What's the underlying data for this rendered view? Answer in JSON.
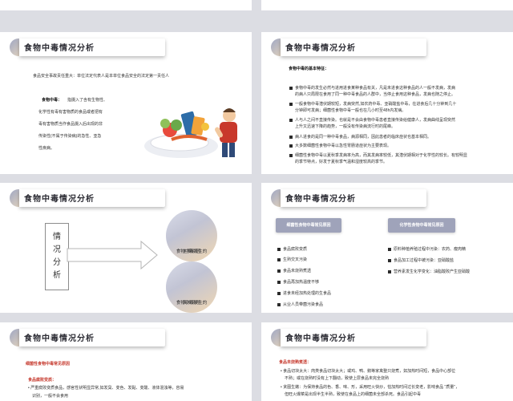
{
  "header_title": "食物中毒情况分析",
  "s1": {
    "intro": "食品安全事故责任重大：单位法定代表人是本单位食品安全的法定第一责任人",
    "def_title": "食物中毒：",
    "def_lines": [
      "指摄入了含有生物性、",
      "化学性有毒有害物质的食品或者把有",
      "毒有害物质当作食品摄入后出现的非",
      "传染性(不属于传染病)的急性、亚急",
      "性疾病。"
    ]
  },
  "s2": {
    "subtitle": "食物中毒的基本特征：",
    "items": [
      [
        "食物中毒的发生必然与进用进食某种食品有关，凡是未进食这种食品的人一般不发病，发病",
        "的病人只局限在食用了同一种中毒食品的人群中，当停止食用这种食品，发病也随之停止。"
      ],
      [
        "一般食物中毒潜伏期较短，发病突然,如农药中毒、亚硝酸盐中毒，在进食后几十分钟到几十",
        "分钟即可发病；细菌性食物中毒一般也在几小时至48h内发病。"
      ],
      [
        "人与人之间不直接传染。也就是不会由食物中毒患者直接传染给健康人，发病曲线呈现突然",
        "上升又迅速下降的趋势，一般没有传染病流行时的尾峰。"
      ],
      [
        "病人进食的是同一种中毒食品，病源相同，因此患者的临床症状也基本相同。"
      ],
      [
        "大多数细菌性食物中毒以急性胃肠道症状为主要表现。"
      ],
      [
        "细菌性食物中毒以夏秋季发病率为高，而其发病率较低，其潜伏期相对于化学性的较长。有较明显",
        "的季节特点，好发于夏秋季气温和湿度较高的季节。"
      ]
    ]
  },
  "s3": {
    "vertical_chars": [
      "情",
      "况",
      "分",
      "析"
    ],
    "circle1": [
      "食物中毒发生的",
      "主要原因"
    ],
    "circle2": [
      "食物中毒发生的",
      "高发场所"
    ]
  },
  "s4": {
    "left_tab": "细菌性食物中毒常见原因",
    "right_tab": "化学性食物中毒常见原因",
    "left_items": [
      "食品腐败变质",
      "生熟交叉污染",
      "食品未烧熟煮透",
      "食品再加热温度不够",
      "进食未经加热处理的生食品",
      "从业人员带菌污染食品"
    ],
    "right_items": [
      "原料种植养殖过程中污染：农药、瘦肉精",
      "食品加工过程中被污染：亚硝酸盐",
      "营养素发生化学变化：油脂酸败产生亚硝酸"
    ]
  },
  "s5": {
    "heading": "细菌性食物中毒常见原因",
    "sub": "食品腐败变质：",
    "lines": [
      "严重腐败变质食品，感官性状明显异常,如发臭、变色、发黏、变酸、液体混浊等，容易",
      "识别，一般不会食用"
    ]
  },
  "s6": {
    "sub": "食品未烧熟煮透：",
    "lines": [
      "食品切块太大：肉类食品切块太大；或鸡、鸭、鹅等家禽整只烧煮，如加热时间短，食品中心部位",
      "不熟；或在烧熟时没有上下翻动，致使上层食品未完全烧熟",
      "贪图生嫩：为保持食品的色、香、味、形，采用旺火快炒，怕加热时间过长变老，影响食品 \"质量\"，",
      "但旺火爆菜是出现半生半熟，致使在食品上的细菌未全部杀死。食品引起中毒"
    ]
  }
}
